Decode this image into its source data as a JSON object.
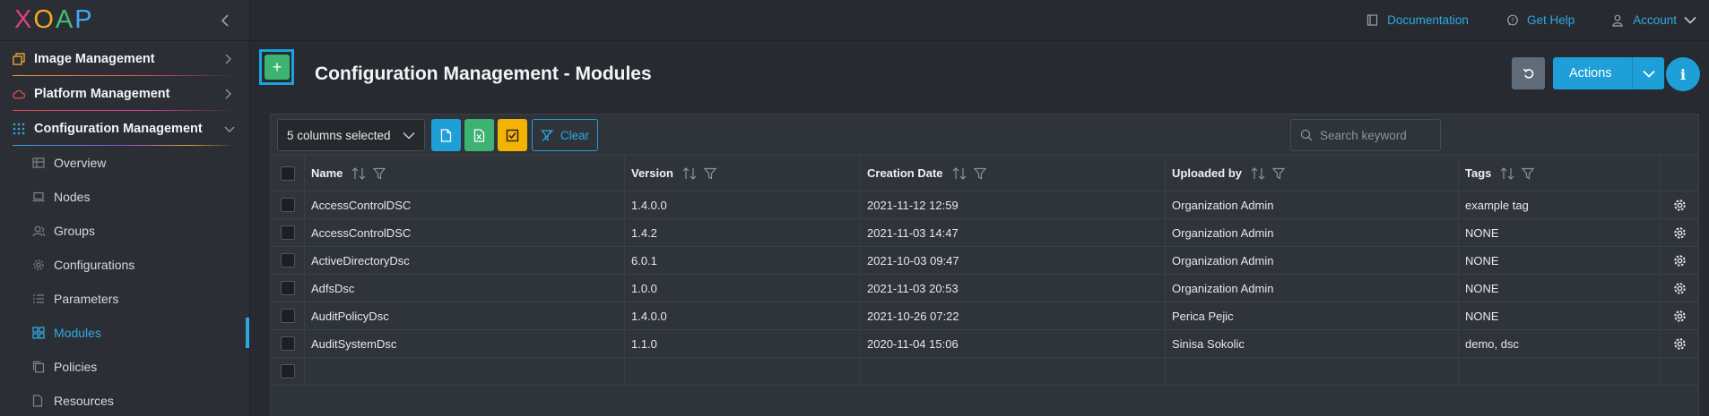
{
  "logo": "XOAP",
  "sidebar": {
    "groups": [
      {
        "label": "Image Management",
        "icon": "image-management-icon",
        "color": "#f0a030"
      },
      {
        "label": "Platform Management",
        "icon": "cloud-icon",
        "color": "#e04848"
      },
      {
        "label": "Configuration Management",
        "icon": "configuration-grid-icon",
        "color": "#2fa8e0"
      }
    ],
    "items": [
      {
        "label": "Overview",
        "icon": "table-icon"
      },
      {
        "label": "Nodes",
        "icon": "laptop-icon"
      },
      {
        "label": "Groups",
        "icon": "users-icon"
      },
      {
        "label": "Configurations",
        "icon": "gear-icon"
      },
      {
        "label": "Parameters",
        "icon": "list-icon"
      },
      {
        "label": "Modules",
        "icon": "modules-grid-icon",
        "active": true
      },
      {
        "label": "Policies",
        "icon": "copy-icon"
      },
      {
        "label": "Resources",
        "icon": "file-icon"
      }
    ]
  },
  "topbar": {
    "documentation": "Documentation",
    "help": "Get Help",
    "account": "Account"
  },
  "page": {
    "title": "Configuration Management - Modules",
    "add_label": "+",
    "actions_label": "Actions",
    "info_label": "i"
  },
  "toolbar": {
    "columns_selected": "5 columns selected",
    "clear_label": "Clear",
    "search_placeholder": "Search keyword"
  },
  "table": {
    "headers": [
      "Name",
      "Version",
      "Creation Date",
      "Uploaded by",
      "Tags"
    ],
    "rows": [
      [
        "AccessControlDSC",
        "1.4.0.0",
        "2021-11-12 12:59",
        "Organization Admin",
        "example tag"
      ],
      [
        "AccessControlDSC",
        "1.4.2",
        "2021-11-03 14:47",
        "Organization Admin",
        "NONE"
      ],
      [
        "ActiveDirectoryDsc",
        "6.0.1",
        "2021-10-03 09:47",
        "Organization Admin",
        "NONE"
      ],
      [
        "AdfsDsc",
        "1.0.0",
        "2021-11-03 20:53",
        "Organization Admin",
        "NONE"
      ],
      [
        "AuditPolicyDsc",
        "1.4.0.0",
        "2021-10-26 07:22",
        "Perica Pejic",
        "NONE"
      ],
      [
        "AuditSystemDsc",
        "1.1.0",
        "2020-11-04 15:06",
        "Sinisa Sokolic",
        "demo, dsc"
      ],
      [
        "",
        "",
        "",
        "",
        ""
      ]
    ]
  },
  "colors": {
    "accent": "#2fa8e0",
    "add_green": "#3cb371",
    "warn_yellow": "#f5b301",
    "bg": "#272b31"
  }
}
